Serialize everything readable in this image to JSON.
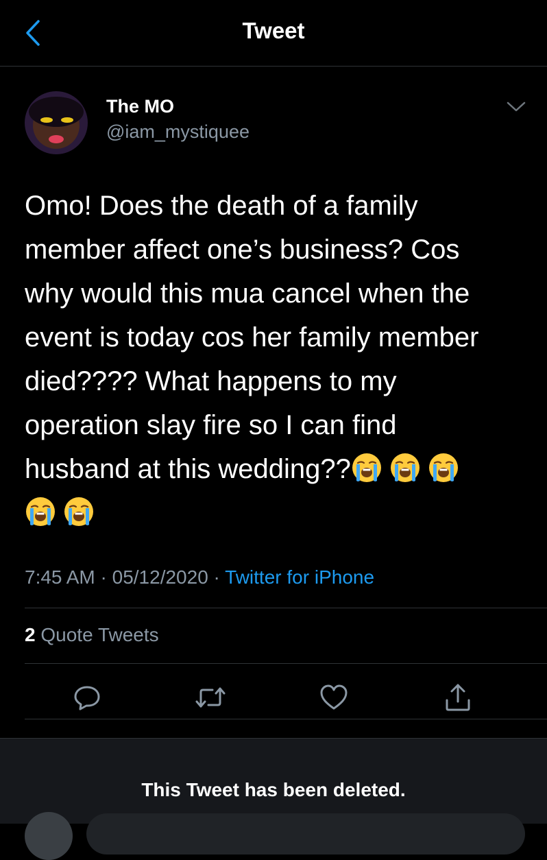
{
  "header": {
    "title": "Tweet",
    "back_icon": "chevron-left-icon"
  },
  "tweet": {
    "author_name": "The MO",
    "author_handle": "@iam_mystiquee",
    "text_line1": "Omo! Does the death of a family",
    "text_line2": "member affect one’s business? Cos",
    "text_line3": "why would this mua cancel when the",
    "text_line4": "event is today cos her family member",
    "text_line5": "died???? What happens to my",
    "text_line6": "operation slay fire so I can find",
    "text_line7": "husband at this wedding??",
    "emoji_name": "loudly-crying-face",
    "emoji_count": 5,
    "time": "7:45 AM",
    "date": "05/12/2020",
    "separator": "·",
    "source": "Twitter for iPhone",
    "quote_count": "2",
    "quote_label": "Quote Tweets"
  },
  "actions": {
    "reply_icon": "reply-icon",
    "retweet_icon": "retweet-icon",
    "like_icon": "like-icon",
    "share_icon": "share-icon"
  },
  "notice": {
    "deleted": "This Tweet has been deleted."
  },
  "colors": {
    "background": "#000000",
    "accent": "#1d9bf0",
    "secondary_text": "#8b98a5",
    "divider": "#2f3336"
  }
}
